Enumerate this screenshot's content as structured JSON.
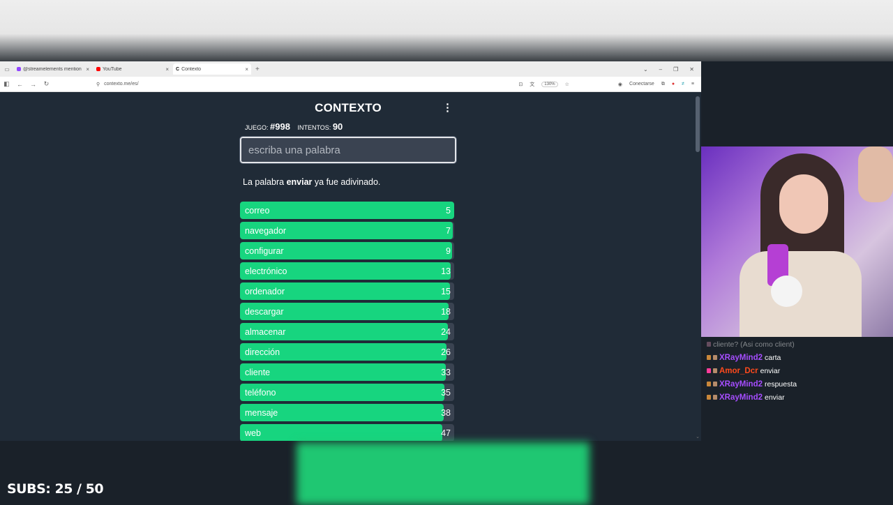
{
  "browser": {
    "tabs": [
      {
        "title": "@streamelements mention",
        "color": "#9146ff",
        "active": false
      },
      {
        "title": "YouTube",
        "color": "#ff0000",
        "active": false
      },
      {
        "title": "Contexto",
        "color": "#1a2129",
        "active": true
      }
    ],
    "new_tab": "+",
    "url": "contexto.me/es/",
    "zoom": "130%",
    "signin_label": "Conectarse"
  },
  "game": {
    "logo": "CONTEXTO",
    "game_label": "JUEGO:",
    "game_number": "#998",
    "attempts_label": "INTENTOS:",
    "attempts": "90",
    "input_placeholder": "escriba una palabra",
    "message_prefix": "La palabra",
    "message_word": "enviar",
    "message_suffix": "ya fue adivinado.",
    "guesses": [
      {
        "word": "correo",
        "rank": "5",
        "fill": 1.0
      },
      {
        "word": "navegador",
        "rank": "7",
        "fill": 0.995
      },
      {
        "word": "configurar",
        "rank": "9",
        "fill": 0.99
      },
      {
        "word": "electrónico",
        "rank": "13",
        "fill": 0.985
      },
      {
        "word": "ordenador",
        "rank": "15",
        "fill": 0.98
      },
      {
        "word": "descargar",
        "rank": "18",
        "fill": 0.975
      },
      {
        "word": "almacenar",
        "rank": "24",
        "fill": 0.97
      },
      {
        "word": "dirección",
        "rank": "26",
        "fill": 0.965
      },
      {
        "word": "cliente",
        "rank": "33",
        "fill": 0.96
      },
      {
        "word": "teléfono",
        "rank": "35",
        "fill": 0.955
      },
      {
        "word": "mensaje",
        "rank": "38",
        "fill": 0.95
      },
      {
        "word": "web",
        "rank": "47",
        "fill": 0.945
      }
    ]
  },
  "chat": [
    {
      "user": "XRayMind2",
      "text": "carta",
      "color": "#a64dff"
    },
    {
      "user": "Amor_Dcr",
      "text": "enviar",
      "color": "#ff4a1c"
    },
    {
      "user": "XRayMind2",
      "text": "respuesta",
      "color": "#a64dff"
    },
    {
      "user": "XRayMind2",
      "text": "enviar",
      "color": "#a64dff"
    }
  ],
  "chat_partial_text": "cliente? (Asi como client)",
  "overlay": {
    "subs": "SUBS: 25 / 50"
  },
  "colors": {
    "bar_green": "#17d57f",
    "page_bg": "#202b37",
    "input_bg": "#3a4351"
  }
}
